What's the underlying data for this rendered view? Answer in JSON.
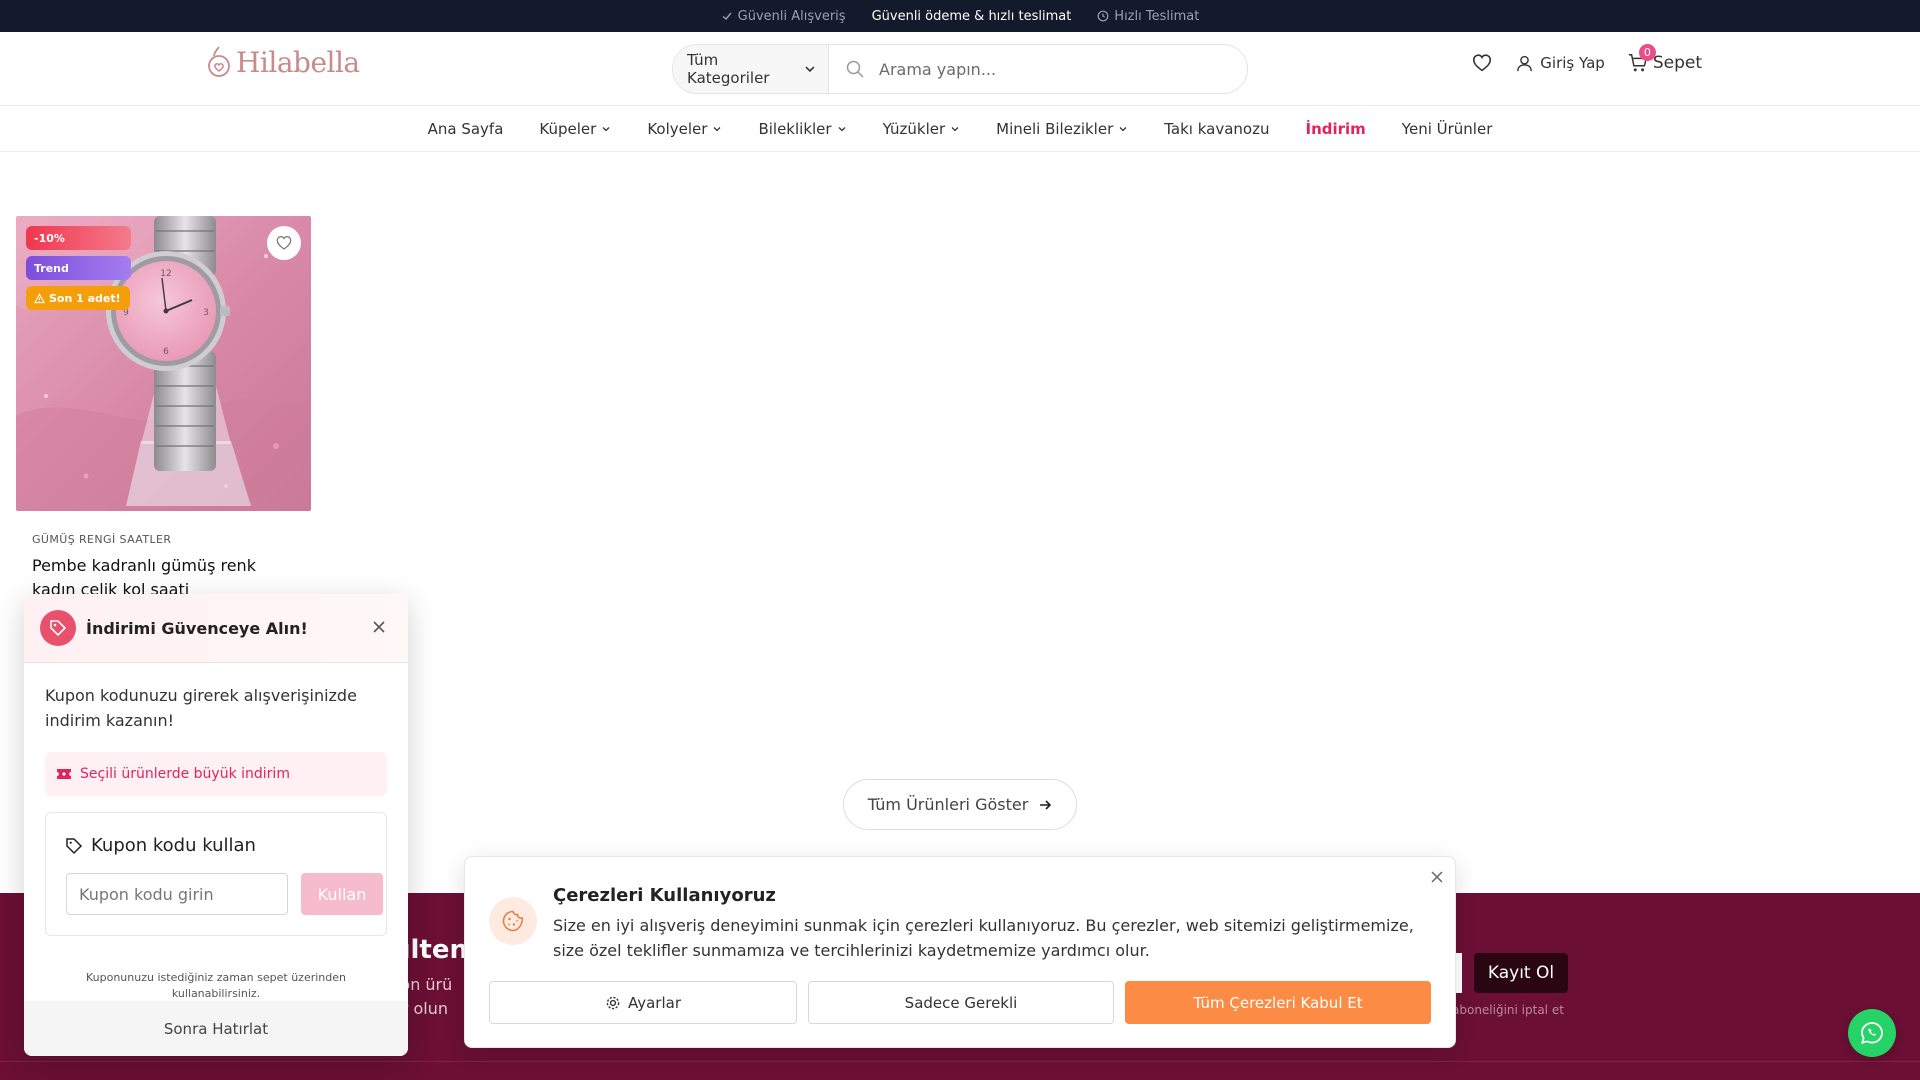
{
  "topbar": {
    "items": [
      {
        "icon": "check-icon",
        "label": "Güvenli Alışveriş"
      },
      {
        "icon": "",
        "label": "Güvenli ödeme & hızlı teslimat"
      },
      {
        "icon": "clock-icon",
        "label": "Hızlı Teslimat"
      }
    ]
  },
  "header": {
    "logo_text": "Hilabella",
    "search": {
      "category_label": "Tüm Kategoriler",
      "placeholder": "Arama yapın..."
    },
    "login_label": "Giriş Yap",
    "cart_label": "Sepet",
    "cart_count": "0"
  },
  "nav": {
    "items": [
      {
        "label": "Ana Sayfa",
        "dropdown": false
      },
      {
        "label": "Küpeler",
        "dropdown": true
      },
      {
        "label": "Kolyeler",
        "dropdown": true
      },
      {
        "label": "Bileklikler",
        "dropdown": true
      },
      {
        "label": "Yüzükler",
        "dropdown": true
      },
      {
        "label": "Mineli Bilezikler",
        "dropdown": true
      },
      {
        "label": "Takı kavanozu",
        "dropdown": false
      },
      {
        "label": "İndirim",
        "dropdown": false
      },
      {
        "label": "Yeni Ürünler",
        "dropdown": false
      }
    ],
    "sale_color": "#e0245e"
  },
  "product": {
    "badges": {
      "discount": "-10%",
      "trend": "Trend",
      "stock": "Son 1 adet!"
    },
    "category": "GÜMÜŞ RENGİ SAATLER",
    "title": "Pembe kadranlı gümüş renk kadın çelik kol saati"
  },
  "show_all_label": "Tüm Ürünleri Göster",
  "newsletter": {
    "title_fragment": "ülten",
    "line1_fragment": "zon ürü",
    "line2_fragment": "ar olun",
    "button_label": "Kayıt Ol",
    "note_fragment": "aboneliğini iptal et",
    "background": "#6b0f34"
  },
  "coupon_popup": {
    "title": "İndirimi Güvenceye Alın!",
    "description": "Kupon kodunuzu girerek alışverişinizde indirim kazanın!",
    "promo": "Seçili ürünlerde büyük indirim",
    "box_title": "Kupon kodu kullan",
    "input_placeholder": "Kupon kodu girin",
    "apply_label": "Kullan",
    "note": "Kuponunuzu istediğiniz zaman sepet üzerinden kullanabilirsiniz.",
    "later_label": "Sonra Hatırlat",
    "accent": "#e8506b"
  },
  "cookie_banner": {
    "title": "Çerezleri Kullanıyoruz",
    "text": "Size en iyi alışveriş deneyimini sunmak için çerezleri kullanıyoruz. Bu çerezler, web sitemizi geliştirmemize, size özel teklifler sunmamıza ve tercihlerinizi kaydetmemize yardımcı olur.",
    "settings_label": "Ayarlar",
    "required_label": "Sadece Gerekli",
    "accept_label": "Tüm Çerezleri Kabul Et",
    "accent": "#fb8b45"
  }
}
